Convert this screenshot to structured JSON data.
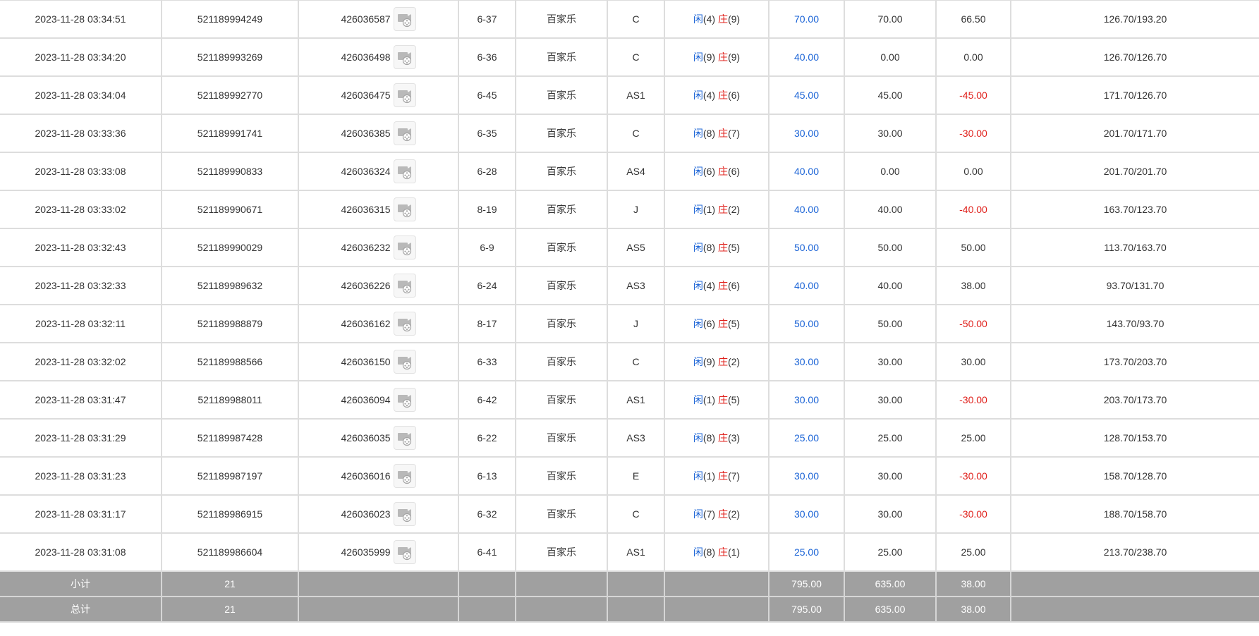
{
  "records": [
    {
      "time": "2023-11-28 03:34:51",
      "bet_id": "521189994249",
      "round_id": "426036587",
      "shoe": "6-37",
      "game": "百家乐",
      "table": "C",
      "player_label": "闲",
      "player_points": "(4)",
      "banker_label": "庄",
      "banker_points": "(9)",
      "bet": "70.00",
      "valid": "70.00",
      "result": "66.50",
      "result_negative": false,
      "balance": "126.70/193.20"
    },
    {
      "time": "2023-11-28 03:34:20",
      "bet_id": "521189993269",
      "round_id": "426036498",
      "shoe": "6-36",
      "game": "百家乐",
      "table": "C",
      "player_label": "闲",
      "player_points": "(9)",
      "banker_label": "庄",
      "banker_points": "(9)",
      "bet": "40.00",
      "valid": "0.00",
      "result": "0.00",
      "result_negative": false,
      "balance": "126.70/126.70"
    },
    {
      "time": "2023-11-28 03:34:04",
      "bet_id": "521189992770",
      "round_id": "426036475",
      "shoe": "6-45",
      "game": "百家乐",
      "table": "AS1",
      "player_label": "闲",
      "player_points": "(4)",
      "banker_label": "庄",
      "banker_points": "(6)",
      "bet": "45.00",
      "valid": "45.00",
      "result": "-45.00",
      "result_negative": true,
      "balance": "171.70/126.70"
    },
    {
      "time": "2023-11-28 03:33:36",
      "bet_id": "521189991741",
      "round_id": "426036385",
      "shoe": "6-35",
      "game": "百家乐",
      "table": "C",
      "player_label": "闲",
      "player_points": "(8)",
      "banker_label": "庄",
      "banker_points": "(7)",
      "bet": "30.00",
      "valid": "30.00",
      "result": "-30.00",
      "result_negative": true,
      "balance": "201.70/171.70"
    },
    {
      "time": "2023-11-28 03:33:08",
      "bet_id": "521189990833",
      "round_id": "426036324",
      "shoe": "6-28",
      "game": "百家乐",
      "table": "AS4",
      "player_label": "闲",
      "player_points": "(6)",
      "banker_label": "庄",
      "banker_points": "(6)",
      "bet": "40.00",
      "valid": "0.00",
      "result": "0.00",
      "result_negative": false,
      "balance": "201.70/201.70"
    },
    {
      "time": "2023-11-28 03:33:02",
      "bet_id": "521189990671",
      "round_id": "426036315",
      "shoe": "8-19",
      "game": "百家乐",
      "table": "J",
      "player_label": "闲",
      "player_points": "(1)",
      "banker_label": "庄",
      "banker_points": "(2)",
      "bet": "40.00",
      "valid": "40.00",
      "result": "-40.00",
      "result_negative": true,
      "balance": "163.70/123.70"
    },
    {
      "time": "2023-11-28 03:32:43",
      "bet_id": "521189990029",
      "round_id": "426036232",
      "shoe": "6-9",
      "game": "百家乐",
      "table": "AS5",
      "player_label": "闲",
      "player_points": "(8)",
      "banker_label": "庄",
      "banker_points": "(5)",
      "bet": "50.00",
      "valid": "50.00",
      "result": "50.00",
      "result_negative": false,
      "balance": "113.70/163.70"
    },
    {
      "time": "2023-11-28 03:32:33",
      "bet_id": "521189989632",
      "round_id": "426036226",
      "shoe": "6-24",
      "game": "百家乐",
      "table": "AS3",
      "player_label": "闲",
      "player_points": "(4)",
      "banker_label": "庄",
      "banker_points": "(6)",
      "bet": "40.00",
      "valid": "40.00",
      "result": "38.00",
      "result_negative": false,
      "balance": "93.70/131.70"
    },
    {
      "time": "2023-11-28 03:32:11",
      "bet_id": "521189988879",
      "round_id": "426036162",
      "shoe": "8-17",
      "game": "百家乐",
      "table": "J",
      "player_label": "闲",
      "player_points": "(6)",
      "banker_label": "庄",
      "banker_points": "(5)",
      "bet": "50.00",
      "valid": "50.00",
      "result": "-50.00",
      "result_negative": true,
      "balance": "143.70/93.70"
    },
    {
      "time": "2023-11-28 03:32:02",
      "bet_id": "521189988566",
      "round_id": "426036150",
      "shoe": "6-33",
      "game": "百家乐",
      "table": "C",
      "player_label": "闲",
      "player_points": "(9)",
      "banker_label": "庄",
      "banker_points": "(2)",
      "bet": "30.00",
      "valid": "30.00",
      "result": "30.00",
      "result_negative": false,
      "balance": "173.70/203.70"
    },
    {
      "time": "2023-11-28 03:31:47",
      "bet_id": "521189988011",
      "round_id": "426036094",
      "shoe": "6-42",
      "game": "百家乐",
      "table": "AS1",
      "player_label": "闲",
      "player_points": "(1)",
      "banker_label": "庄",
      "banker_points": "(5)",
      "bet": "30.00",
      "valid": "30.00",
      "result": "-30.00",
      "result_negative": true,
      "balance": "203.70/173.70"
    },
    {
      "time": "2023-11-28 03:31:29",
      "bet_id": "521189987428",
      "round_id": "426036035",
      "shoe": "6-22",
      "game": "百家乐",
      "table": "AS3",
      "player_label": "闲",
      "player_points": "(8)",
      "banker_label": "庄",
      "banker_points": "(3)",
      "bet": "25.00",
      "valid": "25.00",
      "result": "25.00",
      "result_negative": false,
      "balance": "128.70/153.70"
    },
    {
      "time": "2023-11-28 03:31:23",
      "bet_id": "521189987197",
      "round_id": "426036016",
      "shoe": "6-13",
      "game": "百家乐",
      "table": "E",
      "player_label": "闲",
      "player_points": "(1)",
      "banker_label": "庄",
      "banker_points": "(7)",
      "bet": "30.00",
      "valid": "30.00",
      "result": "-30.00",
      "result_negative": true,
      "balance": "158.70/128.70"
    },
    {
      "time": "2023-11-28 03:31:17",
      "bet_id": "521189986915",
      "round_id": "426036023",
      "shoe": "6-32",
      "game": "百家乐",
      "table": "C",
      "player_label": "闲",
      "player_points": "(7)",
      "banker_label": "庄",
      "banker_points": "(2)",
      "bet": "30.00",
      "valid": "30.00",
      "result": "-30.00",
      "result_negative": true,
      "balance": "188.70/158.70"
    },
    {
      "time": "2023-11-28 03:31:08",
      "bet_id": "521189986604",
      "round_id": "426035999",
      "shoe": "6-41",
      "game": "百家乐",
      "table": "AS1",
      "player_label": "闲",
      "player_points": "(8)",
      "banker_label": "庄",
      "banker_points": "(1)",
      "bet": "25.00",
      "valid": "25.00",
      "result": "25.00",
      "result_negative": false,
      "balance": "213.70/238.70"
    }
  ],
  "subtotal": {
    "label": "小计",
    "count": "21",
    "bet": "795.00",
    "valid": "635.00",
    "result": "38.00"
  },
  "total": {
    "label": "总计",
    "count": "21",
    "bet": "795.00",
    "valid": "635.00",
    "result": "38.00"
  },
  "icons": {
    "replay": "video-replay-icon"
  },
  "colors": {
    "player": "#1a63d6",
    "banker": "#e0201b",
    "negative": "#e0201b",
    "bet_amount": "#1a63d6",
    "summary_bg": "#a0a0a0"
  }
}
